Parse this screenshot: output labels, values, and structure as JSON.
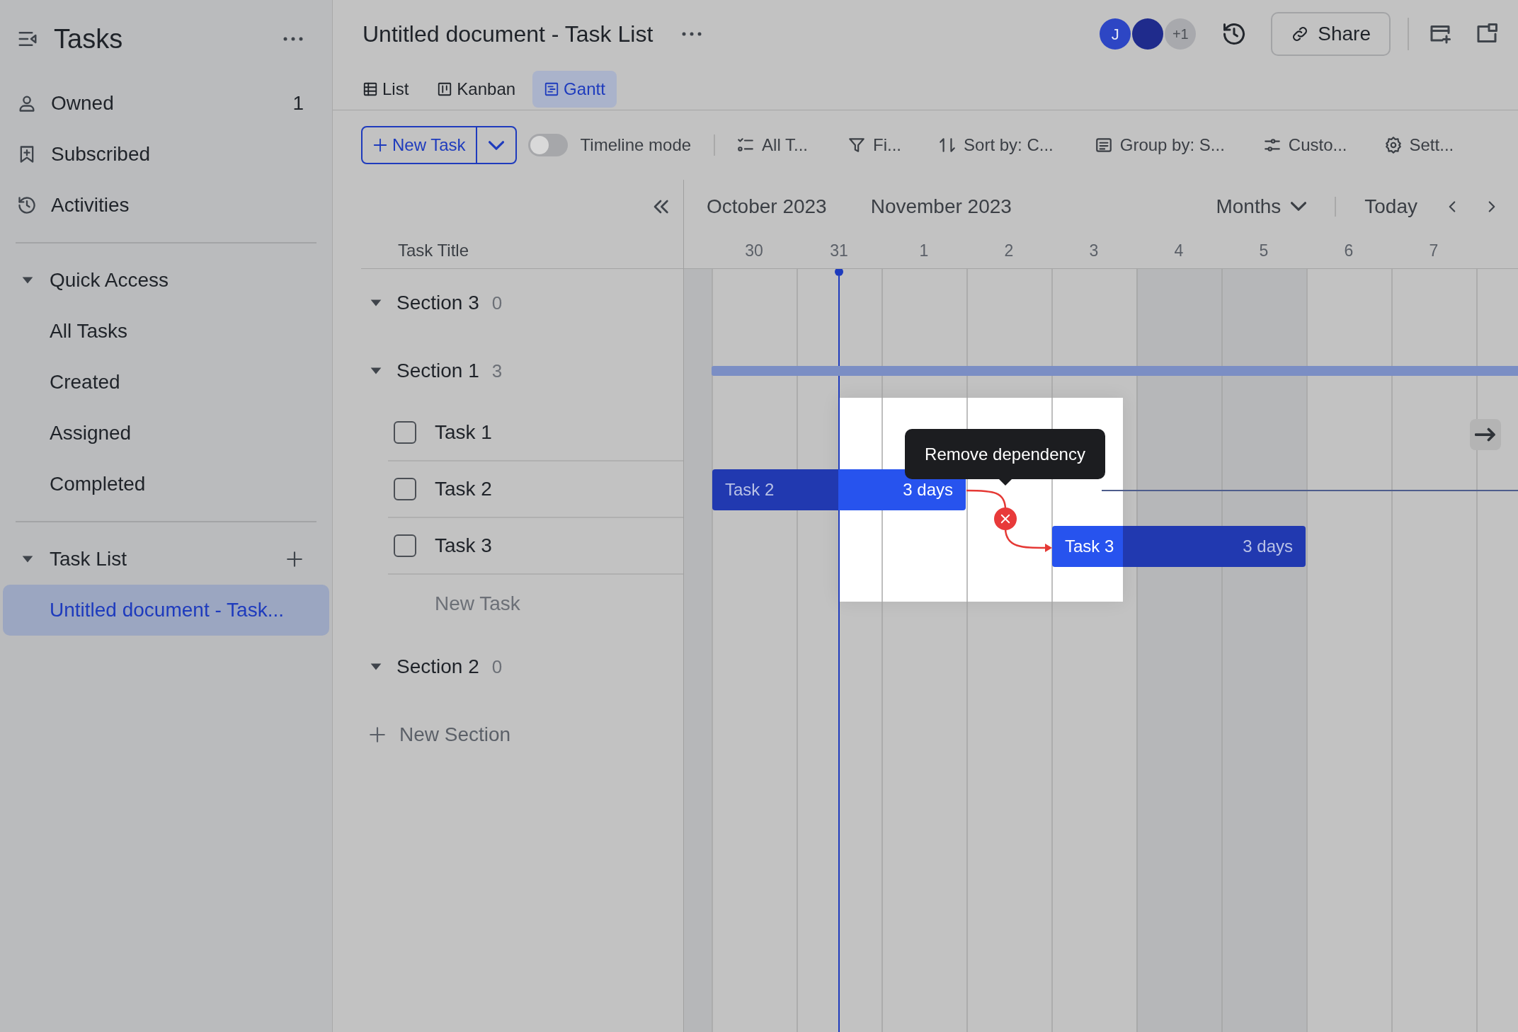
{
  "sidebar": {
    "title": "Tasks",
    "items": [
      {
        "kind": "owned",
        "label": "Owned",
        "count": "1",
        "selected": false
      },
      {
        "kind": "subscribed",
        "label": "Subscribed",
        "selected": false
      },
      {
        "kind": "activities",
        "label": "Activities",
        "selected": false
      }
    ],
    "groups": [
      {
        "title": "Quick Access",
        "expanded": true,
        "items": [
          {
            "label": "All Tasks",
            "selected": false
          },
          {
            "label": "Created",
            "selected": false
          },
          {
            "label": "Assigned",
            "selected": false
          },
          {
            "label": "Completed",
            "selected": false
          }
        ]
      },
      {
        "title": "Task List",
        "expanded": true,
        "can_add": true,
        "items": [
          {
            "label": "Untitled document - Task...",
            "selected": true
          }
        ]
      }
    ]
  },
  "header": {
    "title": "Untitled document - Task List",
    "avatars": [
      {
        "kind": "letter",
        "text": "J",
        "color": "#2d46c4"
      },
      {
        "kind": "blank",
        "color": "#1f2b8c"
      },
      {
        "kind": "count",
        "text": "+1",
        "color": "#a8a9ad"
      }
    ],
    "share": "Share"
  },
  "view_tabs": [
    {
      "kind": "list",
      "label": "List",
      "selected": false
    },
    {
      "kind": "kanban",
      "label": "Kanban",
      "selected": false
    },
    {
      "kind": "gantt",
      "label": "Gantt",
      "selected": true
    }
  ],
  "toolbar": {
    "new_task": "New Task",
    "timeline_mode": {
      "label": "Timeline mode",
      "on": false
    },
    "tools": [
      {
        "kind": "tasks",
        "label": "All T..."
      },
      {
        "kind": "filter",
        "label": "Fi..."
      },
      {
        "kind": "sort",
        "label": "Sort by: C..."
      },
      {
        "kind": "group",
        "label": "Group by: S..."
      },
      {
        "kind": "custom",
        "label": "Custo..."
      },
      {
        "kind": "settings",
        "label": "Sett..."
      }
    ]
  },
  "gantt": {
    "column_header": "Task Title",
    "months": [
      "October 2023",
      "November 2023"
    ],
    "scale": "Months",
    "today": "Today",
    "days": [
      {
        "label": "30",
        "weekend": false,
        "today": false
      },
      {
        "label": "31",
        "weekend": false,
        "today": true
      },
      {
        "label": "1",
        "weekend": false,
        "today": false
      },
      {
        "label": "2",
        "weekend": false,
        "today": false
      },
      {
        "label": "3",
        "weekend": false,
        "today": false
      },
      {
        "label": "4",
        "weekend": true,
        "today": false
      },
      {
        "label": "5",
        "weekend": true,
        "today": false
      },
      {
        "label": "6",
        "weekend": false,
        "today": false
      },
      {
        "label": "7",
        "weekend": false,
        "today": false
      }
    ],
    "sections": [
      {
        "title": "Section 3",
        "count": "0",
        "expanded": true,
        "has_bar": false
      },
      {
        "title": "Section 1",
        "count": "3",
        "expanded": true,
        "has_bar": true,
        "tasks": [
          {
            "title": "Task 1",
            "checked": false
          },
          {
            "title": "Task 2",
            "checked": false,
            "bar_label": "Task 2",
            "duration": "3 days"
          },
          {
            "title": "Task 3",
            "checked": false,
            "bar_label": "Task 3",
            "duration": "3 days"
          }
        ],
        "new_task": "New Task"
      },
      {
        "title": "Section 2",
        "count": "0",
        "expanded": true,
        "has_bar": false
      }
    ],
    "new_section": "New Section",
    "tooltip": "Remove dependency"
  }
}
